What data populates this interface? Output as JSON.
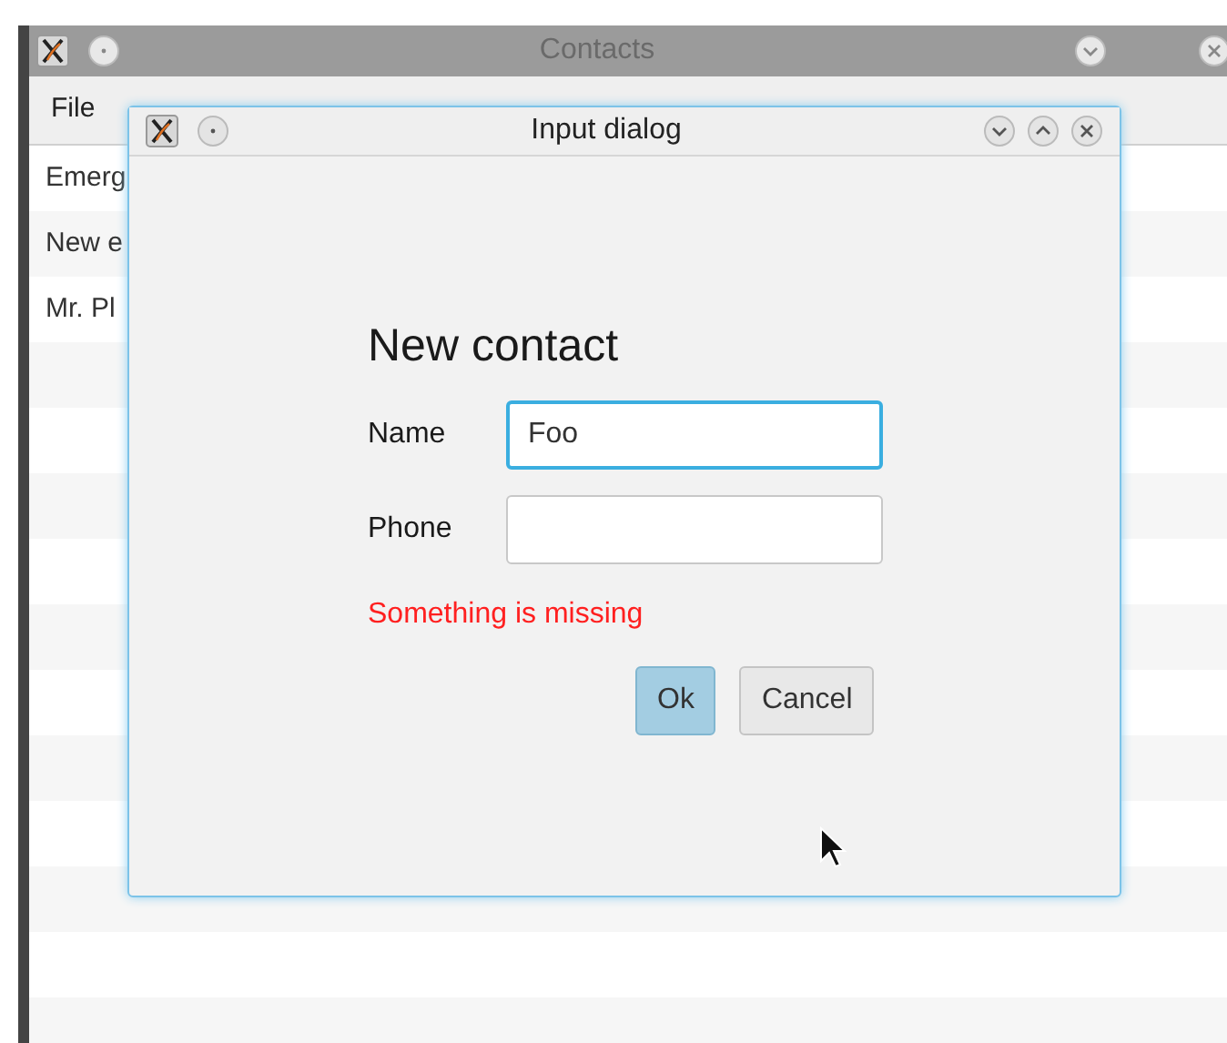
{
  "main_window": {
    "title": "Contacts",
    "menu": [
      {
        "label": "File"
      }
    ],
    "contacts": [
      {
        "name": "Emerg"
      },
      {
        "name": "New e"
      },
      {
        "name": "Mr. Pl"
      }
    ]
  },
  "dialog": {
    "title": "Input dialog",
    "heading": "New contact",
    "fields": [
      {
        "label": "Name",
        "value": "Foo",
        "focused": true
      },
      {
        "label": "Phone",
        "focused": false
      }
    ],
    "error": "Something is missing",
    "buttons": [
      {
        "label": "Ok",
        "default": true
      },
      {
        "label": "Cancel",
        "default": false
      }
    ]
  }
}
